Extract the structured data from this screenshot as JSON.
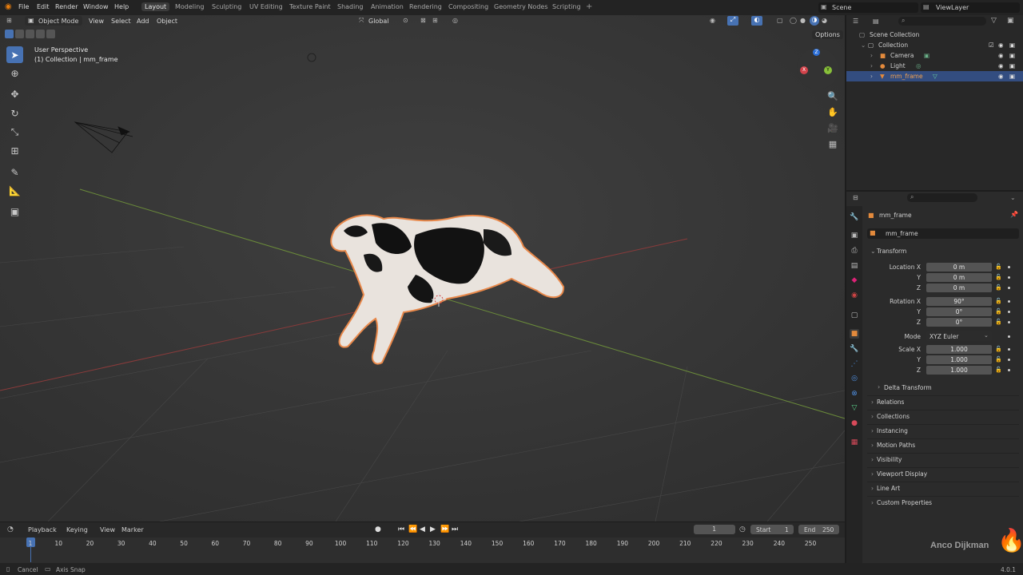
{
  "menu": {
    "file": "File",
    "edit": "Edit",
    "render": "Render",
    "window": "Window",
    "help": "Help"
  },
  "workspaces": [
    "Layout",
    "Modeling",
    "Sculpting",
    "UV Editing",
    "Texture Paint",
    "Shading",
    "Animation",
    "Rendering",
    "Compositing",
    "Geometry Nodes",
    "Scripting"
  ],
  "scene": "Scene",
  "view_layer": "ViewLayer",
  "viewport": {
    "mode": "Object Mode",
    "menus": [
      "View",
      "Select",
      "Add",
      "Object"
    ],
    "orientation": "Global",
    "options": "Options",
    "perspective": "User Perspective",
    "collection_info": "(1) Collection | mm_frame"
  },
  "outliner": {
    "scene_collection": "Scene Collection",
    "collection": "Collection",
    "items": [
      "Camera",
      "Light",
      "mm_frame"
    ]
  },
  "properties": {
    "object_name": "mm_frame",
    "data_name": "mm_frame",
    "transform": "Transform",
    "location_label": "Location X",
    "rotation_label": "Rotation X",
    "scale_label": "Scale X",
    "y": "Y",
    "z": "Z",
    "location": [
      "0 m",
      "0 m",
      "0 m"
    ],
    "rotation": [
      "90°",
      "0°",
      "0°"
    ],
    "mode_label": "Mode",
    "mode_value": "XYZ Euler",
    "scale": [
      "1.000",
      "1.000",
      "1.000"
    ],
    "delta_transform": "Delta Transform",
    "sections": [
      "Relations",
      "Collections",
      "Instancing",
      "Motion Paths",
      "Visibility",
      "Viewport Display",
      "Line Art",
      "Custom Properties"
    ]
  },
  "timeline": {
    "playback": "Playback",
    "keying": "Keying",
    "view": "View",
    "marker": "Marker",
    "current_frame": "1",
    "start_label": "Start",
    "start": "1",
    "end_label": "End",
    "end": "250",
    "ticks": [
      "1",
      "10",
      "20",
      "30",
      "40",
      "50",
      "60",
      "70",
      "80",
      "90",
      "100",
      "110",
      "120",
      "130",
      "140",
      "150",
      "160",
      "170",
      "180",
      "190",
      "200",
      "210",
      "220",
      "230",
      "240",
      "250"
    ]
  },
  "status": {
    "cancel": "Cancel",
    "axis_snap": "Axis Snap",
    "version": "4.0.1"
  },
  "watermark": "Anco Dijkman"
}
